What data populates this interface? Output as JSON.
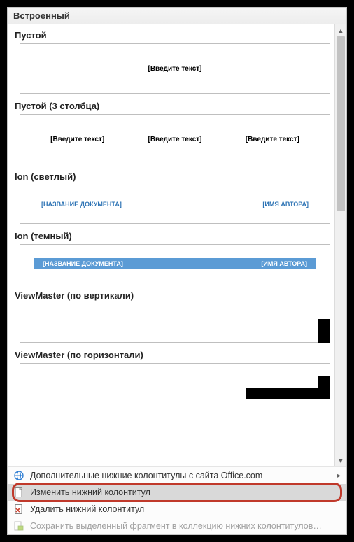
{
  "header": {
    "title": "Встроенный"
  },
  "gallery": {
    "items": [
      {
        "label": "Пустой",
        "kind": "single",
        "ph": "[Введите текст]"
      },
      {
        "label": "Пустой (3 столбца)",
        "kind": "cols3",
        "ph": "[Введите текст]"
      },
      {
        "label": "Ion (светлый)",
        "kind": "ionLight",
        "doc": "[НАЗВАНИЕ ДОКУМЕНТА]",
        "author": "[ИМЯ АВТОРА]"
      },
      {
        "label": "Ion (темный)",
        "kind": "ionDark",
        "doc": "[НАЗВАНИЕ ДОКУМЕНТА]",
        "author": "[ИМЯ АВТОРА]"
      },
      {
        "label": "ViewMaster (по вертикали)",
        "kind": "vmv"
      },
      {
        "label": "ViewMaster (по горизонтали)",
        "kind": "vmh"
      }
    ]
  },
  "footer": {
    "more": "Дополнительные нижние колонтитулы с сайта Office.com",
    "edit": "Изменить нижний колонтитул",
    "remove": "Удалить нижний колонтитул",
    "save": "Сохранить выделенный фрагмент в коллекцию нижних колонтитулов…"
  }
}
